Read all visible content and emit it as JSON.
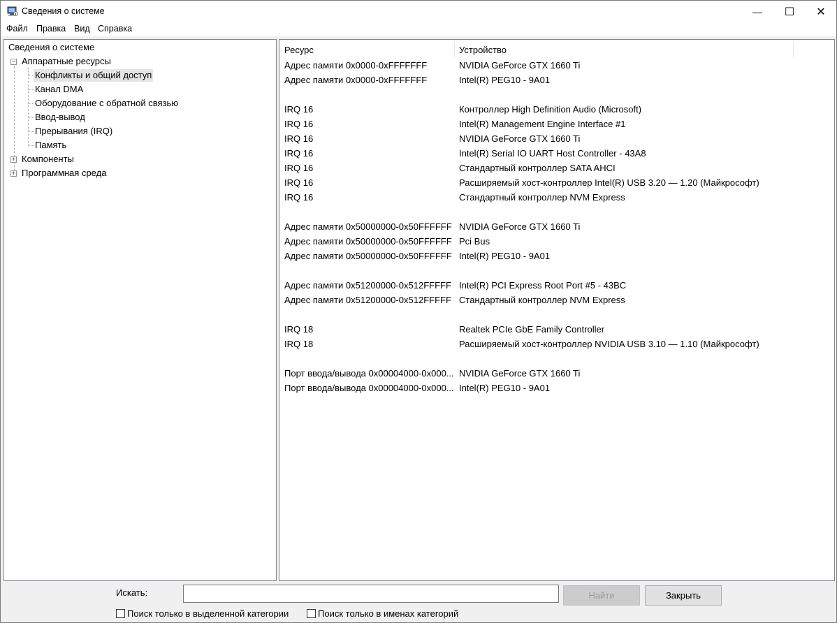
{
  "window": {
    "title": "Сведения о системе",
    "minimize_glyph": "—",
    "maximize_glyph": "☐",
    "close_glyph": "✕"
  },
  "menu": [
    "Файл",
    "Правка",
    "Вид",
    "Справка"
  ],
  "tree": {
    "root": "Сведения о системе",
    "hardware": "Аппаратные ресурсы",
    "hardware_toggle": "−",
    "children": [
      "Конфликты и общий доступ",
      "Канал DMA",
      "Оборудование с обратной связью",
      "Ввод-вывод",
      "Прерывания (IRQ)",
      "Память"
    ],
    "components": "Компоненты",
    "software": "Программная среда",
    "collapsed_toggle": "+"
  },
  "table": {
    "headers": [
      "Ресурс",
      "Устройство"
    ],
    "rows": [
      [
        "Адрес памяти 0x0000-0xFFFFFFF",
        "NVIDIA GeForce GTX 1660 Ti"
      ],
      [
        "Адрес памяти 0x0000-0xFFFFFFF",
        "Intel(R) PEG10 - 9A01"
      ],
      [
        "",
        ""
      ],
      [
        "IRQ 16",
        "Контроллер High Definition Audio (Microsoft)"
      ],
      [
        "IRQ 16",
        "Intel(R) Management Engine Interface #1"
      ],
      [
        "IRQ 16",
        "NVIDIA GeForce GTX 1660 Ti"
      ],
      [
        "IRQ 16",
        "Intel(R) Serial IO UART Host Controller - 43A8"
      ],
      [
        "IRQ 16",
        "Стандартный контроллер SATA AHCI"
      ],
      [
        "IRQ 16",
        "Расширяемый хост-контроллер Intel(R) USB 3.20 — 1.20 (Майкрософт)"
      ],
      [
        "IRQ 16",
        "Стандартный контроллер NVM Express"
      ],
      [
        "",
        ""
      ],
      [
        "Адрес памяти 0x50000000-0x50FFFFFF",
        "NVIDIA GeForce GTX 1660 Ti"
      ],
      [
        "Адрес памяти 0x50000000-0x50FFFFFF",
        "Pci Bus"
      ],
      [
        "Адрес памяти 0x50000000-0x50FFFFFF",
        "Intel(R) PEG10 - 9A01"
      ],
      [
        "",
        ""
      ],
      [
        "Адрес памяти 0x51200000-0x512FFFFF",
        "Intel(R) PCI Express Root Port #5 - 43BC"
      ],
      [
        "Адрес памяти 0x51200000-0x512FFFFF",
        "Стандартный контроллер NVM Express"
      ],
      [
        "",
        ""
      ],
      [
        "IRQ 18",
        "Realtek PCIe GbE Family Controller"
      ],
      [
        "IRQ 18",
        "Расширяемый хост-контроллер NVIDIA USB 3.10 — 1.10 (Майкрософт)"
      ],
      [
        "",
        ""
      ],
      [
        "Порт ввода/вывода 0x00004000-0x000...",
        "NVIDIA GeForce GTX 1660 Ti"
      ],
      [
        "Порт ввода/вывода 0x00004000-0x000...",
        "Intel(R) PEG10 - 9A01"
      ]
    ]
  },
  "search": {
    "label": "Искать:",
    "value": "",
    "find_button": "Найти",
    "close_button": "Закрыть",
    "option_selected_category": "Поиск только в выделенной категории",
    "option_category_names": "Поиск только в именах категорий"
  }
}
